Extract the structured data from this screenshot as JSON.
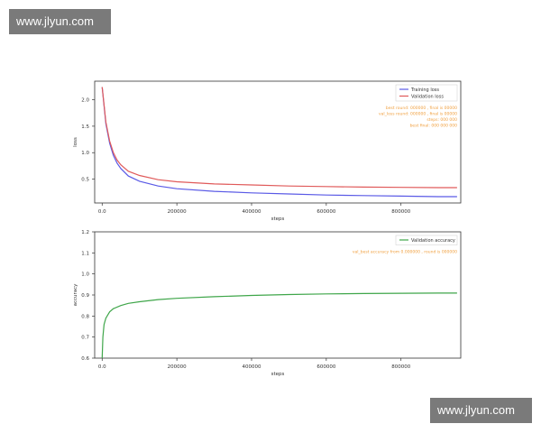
{
  "watermark": {
    "top_text": "www.jlyun.com",
    "bottom_text": "www.jlyun.com"
  },
  "colors": {
    "training": "#5a5ae6",
    "validation_loss": "#e05a5a",
    "validation_accuracy": "#3fa64a",
    "annotation": "#f0a040"
  },
  "chart_data": [
    {
      "type": "line",
      "title": "",
      "xlabel": "steps",
      "ylabel": "loss",
      "xlim": [
        -20000,
        960000
      ],
      "ylim": [
        0.05,
        2.35
      ],
      "xticks": [
        0,
        200000,
        400000,
        600000,
        800000
      ],
      "yticks": [
        0.5,
        1.0,
        1.5,
        2.0
      ],
      "grid": false,
      "legend_position": "top-right",
      "series": [
        {
          "name": "Training loss",
          "color": "#5a5ae6",
          "x": [
            0,
            10000,
            20000,
            30000,
            40000,
            50000,
            70000,
            100000,
            150000,
            200000,
            300000,
            400000,
            500000,
            600000,
            700000,
            800000,
            900000,
            950000
          ],
          "y": [
            2.24,
            1.55,
            1.18,
            0.95,
            0.8,
            0.7,
            0.56,
            0.46,
            0.37,
            0.32,
            0.27,
            0.24,
            0.22,
            0.2,
            0.19,
            0.18,
            0.17,
            0.17
          ]
        },
        {
          "name": "Validation loss",
          "color": "#e05a5a",
          "x": [
            0,
            10000,
            20000,
            30000,
            40000,
            50000,
            70000,
            100000,
            150000,
            200000,
            300000,
            400000,
            500000,
            600000,
            700000,
            800000,
            900000,
            950000
          ],
          "y": [
            2.24,
            1.58,
            1.22,
            1.0,
            0.86,
            0.77,
            0.65,
            0.57,
            0.49,
            0.45,
            0.41,
            0.39,
            0.37,
            0.36,
            0.35,
            0.345,
            0.34,
            0.34
          ]
        }
      ],
      "annotations": [
        "best round: 000000 , final is 00000",
        "val_loss round: 000000 , final is 00000",
        "steps: 000 000",
        "best final: 000 000 000"
      ]
    },
    {
      "type": "line",
      "title": "",
      "xlabel": "steps",
      "ylabel": "accuracy",
      "xlim": [
        -20000,
        960000
      ],
      "ylim": [
        0.6,
        1.2
      ],
      "xticks": [
        0,
        200000,
        400000,
        600000,
        800000
      ],
      "yticks": [
        0.6,
        0.7,
        0.8,
        0.9,
        1.0,
        1.1,
        1.2
      ],
      "grid": false,
      "legend_position": "top-right",
      "series": [
        {
          "name": "Validation accuracy",
          "color": "#3fa64a",
          "x": [
            0,
            2000,
            5000,
            10000,
            20000,
            30000,
            50000,
            70000,
            100000,
            150000,
            200000,
            300000,
            400000,
            500000,
            600000,
            700000,
            800000,
            900000,
            950000
          ],
          "y": [
            0.6,
            0.7,
            0.76,
            0.79,
            0.82,
            0.835,
            0.85,
            0.86,
            0.868,
            0.878,
            0.884,
            0.892,
            0.898,
            0.902,
            0.905,
            0.907,
            0.908,
            0.909,
            0.909
          ]
        }
      ],
      "annotations": [
        "val_best accuracy from 0.000000 , round is 000000"
      ]
    }
  ]
}
